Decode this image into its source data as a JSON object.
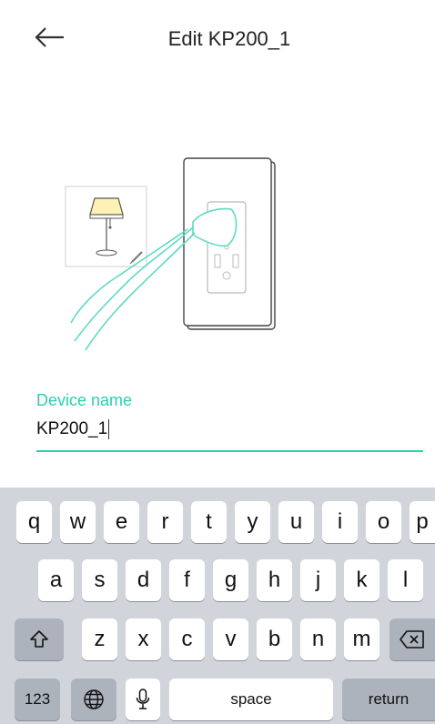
{
  "header": {
    "title": "Edit KP200_1"
  },
  "field": {
    "label": "Device name",
    "value": "KP200_1"
  },
  "keyboard": {
    "row1": [
      "q",
      "w",
      "e",
      "r",
      "t",
      "y",
      "u",
      "i",
      "o",
      "p"
    ],
    "row2": [
      "a",
      "s",
      "d",
      "f",
      "g",
      "h",
      "j",
      "k",
      "l"
    ],
    "row3": [
      "z",
      "x",
      "c",
      "v",
      "b",
      "n",
      "m"
    ],
    "numbers_label": "123",
    "space_label": "space",
    "return_label": "return"
  },
  "colors": {
    "accent": "#2ccfb2",
    "keyboard_bg": "#d1d5db",
    "dark_key": "#adb3bd"
  },
  "icons": [
    "arrow-left-icon",
    "lamp-icon",
    "pencil-icon",
    "outlet-icon",
    "plug-icon",
    "shift-icon",
    "backspace-icon",
    "globe-icon",
    "mic-icon"
  ]
}
